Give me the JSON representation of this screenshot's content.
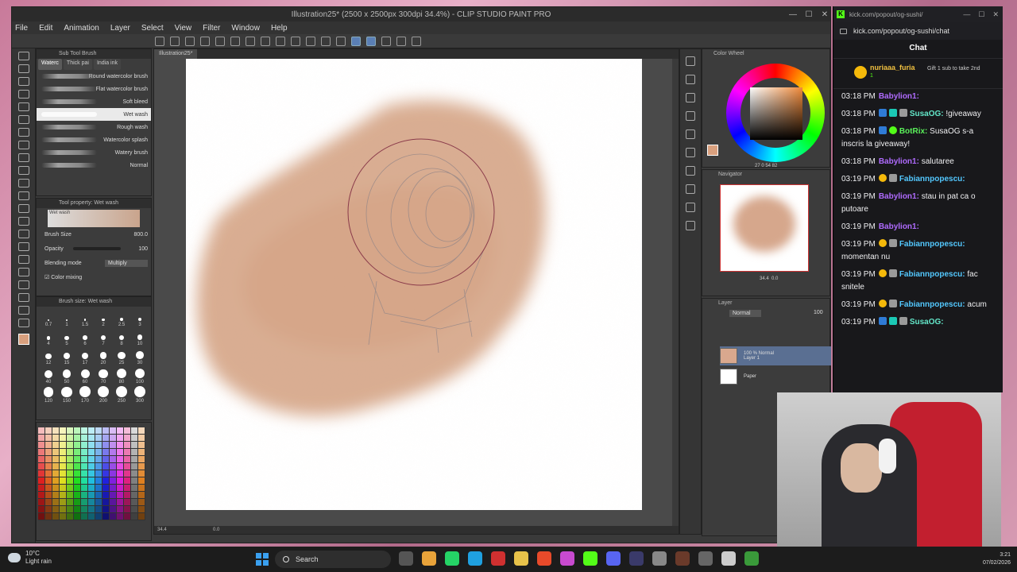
{
  "csp": {
    "title": "Illustration25* (2500 x 2500px 300dpi 34.4%) - CLIP STUDIO PAINT PRO",
    "menu": [
      "File",
      "Edit",
      "Animation",
      "Layer",
      "Select",
      "View",
      "Filter",
      "Window",
      "Help"
    ],
    "canvas_tab": "Illustration25*",
    "subtool": {
      "header": "Sub Tool Brush",
      "tabs": [
        "Waterc",
        "Thick pai",
        "India ink"
      ],
      "brushes": [
        "Round watercolor brush",
        "Flat watercolor brush",
        "Soft bleed",
        "Wet wash",
        "Rough wash",
        "Watercolor splash",
        "Watery brush",
        "Normal"
      ],
      "selected_index": 3
    },
    "tool_property": {
      "header": "Tool property: Wet wash",
      "preview_label": "Wet wash",
      "brush_size_label": "Brush Size",
      "brush_size_value": "800.0",
      "opacity_label": "Opacity",
      "opacity_value": "100",
      "blending_label": "Blending mode",
      "blending_value": "Multiply",
      "color_mixing_label": "Color mixing"
    },
    "brush_size": {
      "header": "Brush size: Wet wash",
      "sizes": [
        "0.7",
        "1",
        "1.5",
        "2",
        "2.5",
        "3",
        "4",
        "5",
        "6",
        "7",
        "8",
        "10",
        "12",
        "15",
        "17",
        "20",
        "25",
        "30",
        "40",
        "50",
        "60",
        "70",
        "80",
        "100",
        "120",
        "150",
        "170",
        "200",
        "250",
        "300"
      ]
    },
    "color_wheel": {
      "header": "Color Wheel",
      "values": "27  0  54  82"
    },
    "navigator": {
      "header": "Navigator",
      "zoom": "34.4",
      "angle": "0.0"
    },
    "layer": {
      "header": "Layer",
      "blend": "Normal",
      "opacity": "100",
      "layers": [
        {
          "line1": "100 % Normal",
          "line2": "Layer 1"
        },
        {
          "line1": "",
          "line2": "Paper"
        }
      ]
    },
    "status": {
      "zoom": "34.4",
      "angle": "0.0"
    }
  },
  "browser": {
    "tab_title": "kick.com/popout/og-sushi/",
    "url": "kick.com/popout/og-sushi/chat",
    "chat_title": "Chat",
    "pinned": {
      "user": "nuriaaa_furia",
      "count": "1",
      "gift": "Gift 1 sub to take 2nd"
    },
    "messages": [
      {
        "time": "03:18 PM",
        "name": "Babylion1:",
        "text": "",
        "color": "purple",
        "badges": []
      },
      {
        "time": "03:18 PM",
        "name": "SusaOG:",
        "text": "!giveaway",
        "color": "teal",
        "badges": [
          "blue",
          "teal",
          "gray"
        ]
      },
      {
        "time": "03:18 PM",
        "name": "BotRix:",
        "text": "SusaOG s-a inscris la giveaway!",
        "color": "green",
        "badges": [
          "blue",
          "green"
        ]
      },
      {
        "time": "03:18 PM",
        "name": "Babylion1:",
        "text": "salutaree",
        "color": "purple",
        "badges": []
      },
      {
        "time": "03:19 PM",
        "name": "Fabiannpopescu:",
        "text": "",
        "color": "cyan",
        "badges": [
          "gold",
          "gray"
        ]
      },
      {
        "time": "03:19 PM",
        "name": "Babylion1:",
        "text": "stau in pat ca o putoare",
        "color": "purple",
        "badges": []
      },
      {
        "time": "03:19 PM",
        "name": "Babylion1:",
        "text": "",
        "color": "purple",
        "badges": []
      },
      {
        "time": "03:19 PM",
        "name": "Fabiannpopescu:",
        "text": "momentan nu",
        "color": "cyan",
        "badges": [
          "gold",
          "gray"
        ]
      },
      {
        "time": "03:19 PM",
        "name": "Fabiannpopescu:",
        "text": "fac snitele",
        "color": "cyan",
        "badges": [
          "gold",
          "gray"
        ]
      },
      {
        "time": "03:19 PM",
        "name": "Fabiannpopescu:",
        "text": "acum",
        "color": "cyan",
        "badges": [
          "gold",
          "gray"
        ]
      },
      {
        "time": "03:19 PM",
        "name": "SusaOG:",
        "text": "",
        "color": "teal",
        "badges": [
          "blue",
          "teal",
          "gray"
        ]
      }
    ]
  },
  "taskbar": {
    "temp": "10°C",
    "weather": "Light rain",
    "search": "Search",
    "date": "07/02/2026",
    "time": "3:21"
  }
}
